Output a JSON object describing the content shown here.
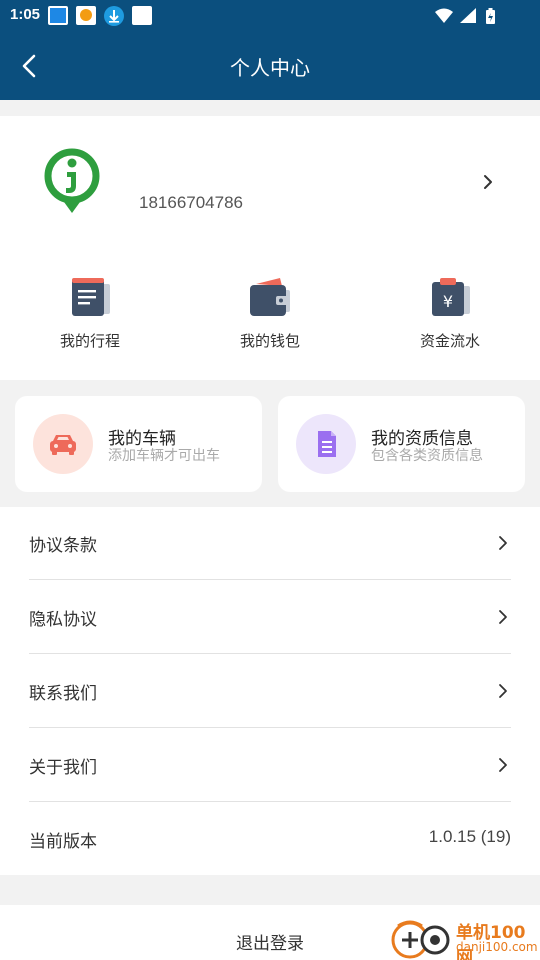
{
  "status_bar": {
    "time": "1:05"
  },
  "header": {
    "title": "个人中心"
  },
  "profile": {
    "phone": "18166704786"
  },
  "shortcuts": [
    {
      "label": "我的行程",
      "icon": "itinerary-icon"
    },
    {
      "label": "我的钱包",
      "icon": "wallet-icon"
    },
    {
      "label": "资金流水",
      "icon": "fund-flow-icon"
    }
  ],
  "cards": [
    {
      "title": "我的车辆",
      "subtitle": "添加车辆才可出车",
      "icon": "car-icon"
    },
    {
      "title": "我的资质信息",
      "subtitle": "包含各类资质信息",
      "icon": "document-icon"
    }
  ],
  "menu": {
    "agreement": "协议条款",
    "privacy": "隐私协议",
    "contact": "联系我们",
    "about": "关于我们",
    "version_label": "当前版本",
    "version_value": "1.0.15 (19)"
  },
  "logout": "退出登录",
  "watermark": {
    "title": "单机100网",
    "url": "danji100.com"
  },
  "colors": {
    "header_bg": "#0b4f7e",
    "accent_green": "#2e9e3e",
    "car_red": "#ee6a5a",
    "doc_purple": "#9b6ff0"
  }
}
